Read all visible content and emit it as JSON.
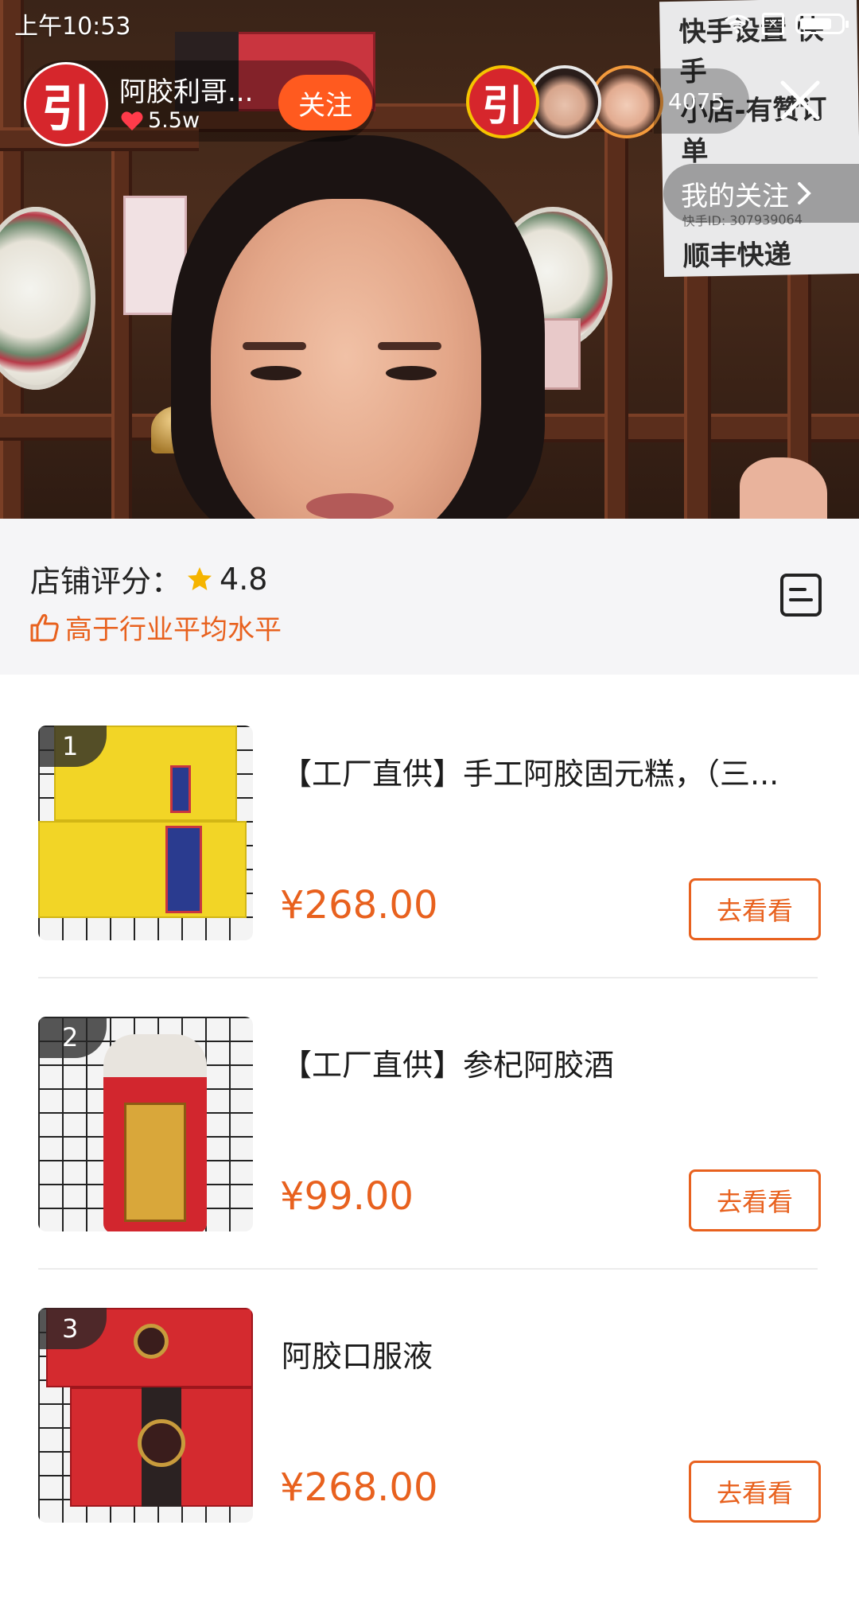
{
  "status_bar": {
    "time": "上午10:53"
  },
  "live": {
    "anchor_name": "阿胶利哥...",
    "likes": "5.5w",
    "follow_label": "关注",
    "viewer_count": "4075",
    "my_follow_label": "我的关注",
    "background_sign": [
      "快手设置 快手",
      "小店-有赞订单",
      "快手ID: 307939064",
      "顺丰快递"
    ]
  },
  "shop": {
    "rating_label": "店铺评分：",
    "rating_value": "4.8",
    "compare_text": "高于行业平均水平"
  },
  "products": [
    {
      "rank": "1",
      "title": "【工厂直供】手工阿胶固元糕，（三...",
      "price": "¥268.00",
      "button": "去看看"
    },
    {
      "rank": "2",
      "title": "【工厂直供】参杞阿胶酒",
      "price": "¥99.00",
      "button": "去看看"
    },
    {
      "rank": "3",
      "title": "阿胶口服液",
      "price": "¥268.00",
      "button": "去看看"
    }
  ],
  "colors": {
    "accent": "#e8611e",
    "follow_button": "#ff5a1f",
    "star": "#f5b400",
    "panel_bg": "#f5f5f7"
  },
  "icons": [
    "wifi-icon",
    "sim-icon",
    "battery-icon",
    "heart-icon",
    "close-icon",
    "chevron-right-icon",
    "star-icon",
    "thumbs-up-icon",
    "list-icon"
  ]
}
